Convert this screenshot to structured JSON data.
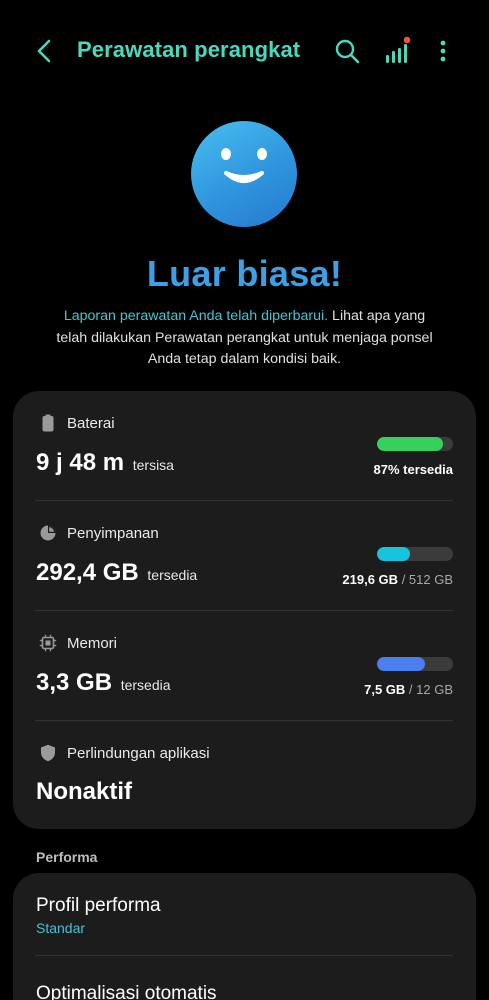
{
  "header": {
    "title": "Perawatan perangkat",
    "back_icon": "chevron-left-icon",
    "search_icon": "search-icon",
    "signal_icon": "signal-bars-icon",
    "more_icon": "more-vertical-icon",
    "accent_color": "#4ad9bd"
  },
  "hero": {
    "face_icon": "smiley-face-icon",
    "headline": "Luar biasa!",
    "desc_highlight": "Laporan perawatan Anda telah diperbarui.",
    "desc_line1_rest": " Lihat apa yang",
    "desc_line2": "telah dilakukan Perawatan perangkat untuk menjaga ponsel",
    "desc_line3": "Anda tetap dalam kondisi baik."
  },
  "status": {
    "battery": {
      "label": "Baterai",
      "icon": "battery-icon",
      "value": "9 j 48 m",
      "unit": "tersisa",
      "stat": "87% tersedia",
      "percent": 87,
      "color": "#36d15d"
    },
    "storage": {
      "label": "Penyimpanan",
      "icon": "storage-pie-icon",
      "value": "292,4 GB",
      "unit": "tersedia",
      "used": "219,6 GB",
      "total": "/ 512 GB",
      "percent": 43,
      "color": "#18c4dc"
    },
    "memory": {
      "label": "Memori",
      "icon": "memory-chip-icon",
      "value": "3,3 GB",
      "unit": "tersedia",
      "used": "7,5 GB",
      "total": "/ 12 GB",
      "percent": 63,
      "color": "#4a7ef1"
    },
    "protection": {
      "label": "Perlindungan aplikasi",
      "icon": "shield-icon",
      "value": "Nonaktif"
    }
  },
  "performance": {
    "section_title": "Performa",
    "profile_title": "Profil performa",
    "profile_value": "Standar",
    "auto_opt_title": "Optimalisasi otomatis"
  }
}
